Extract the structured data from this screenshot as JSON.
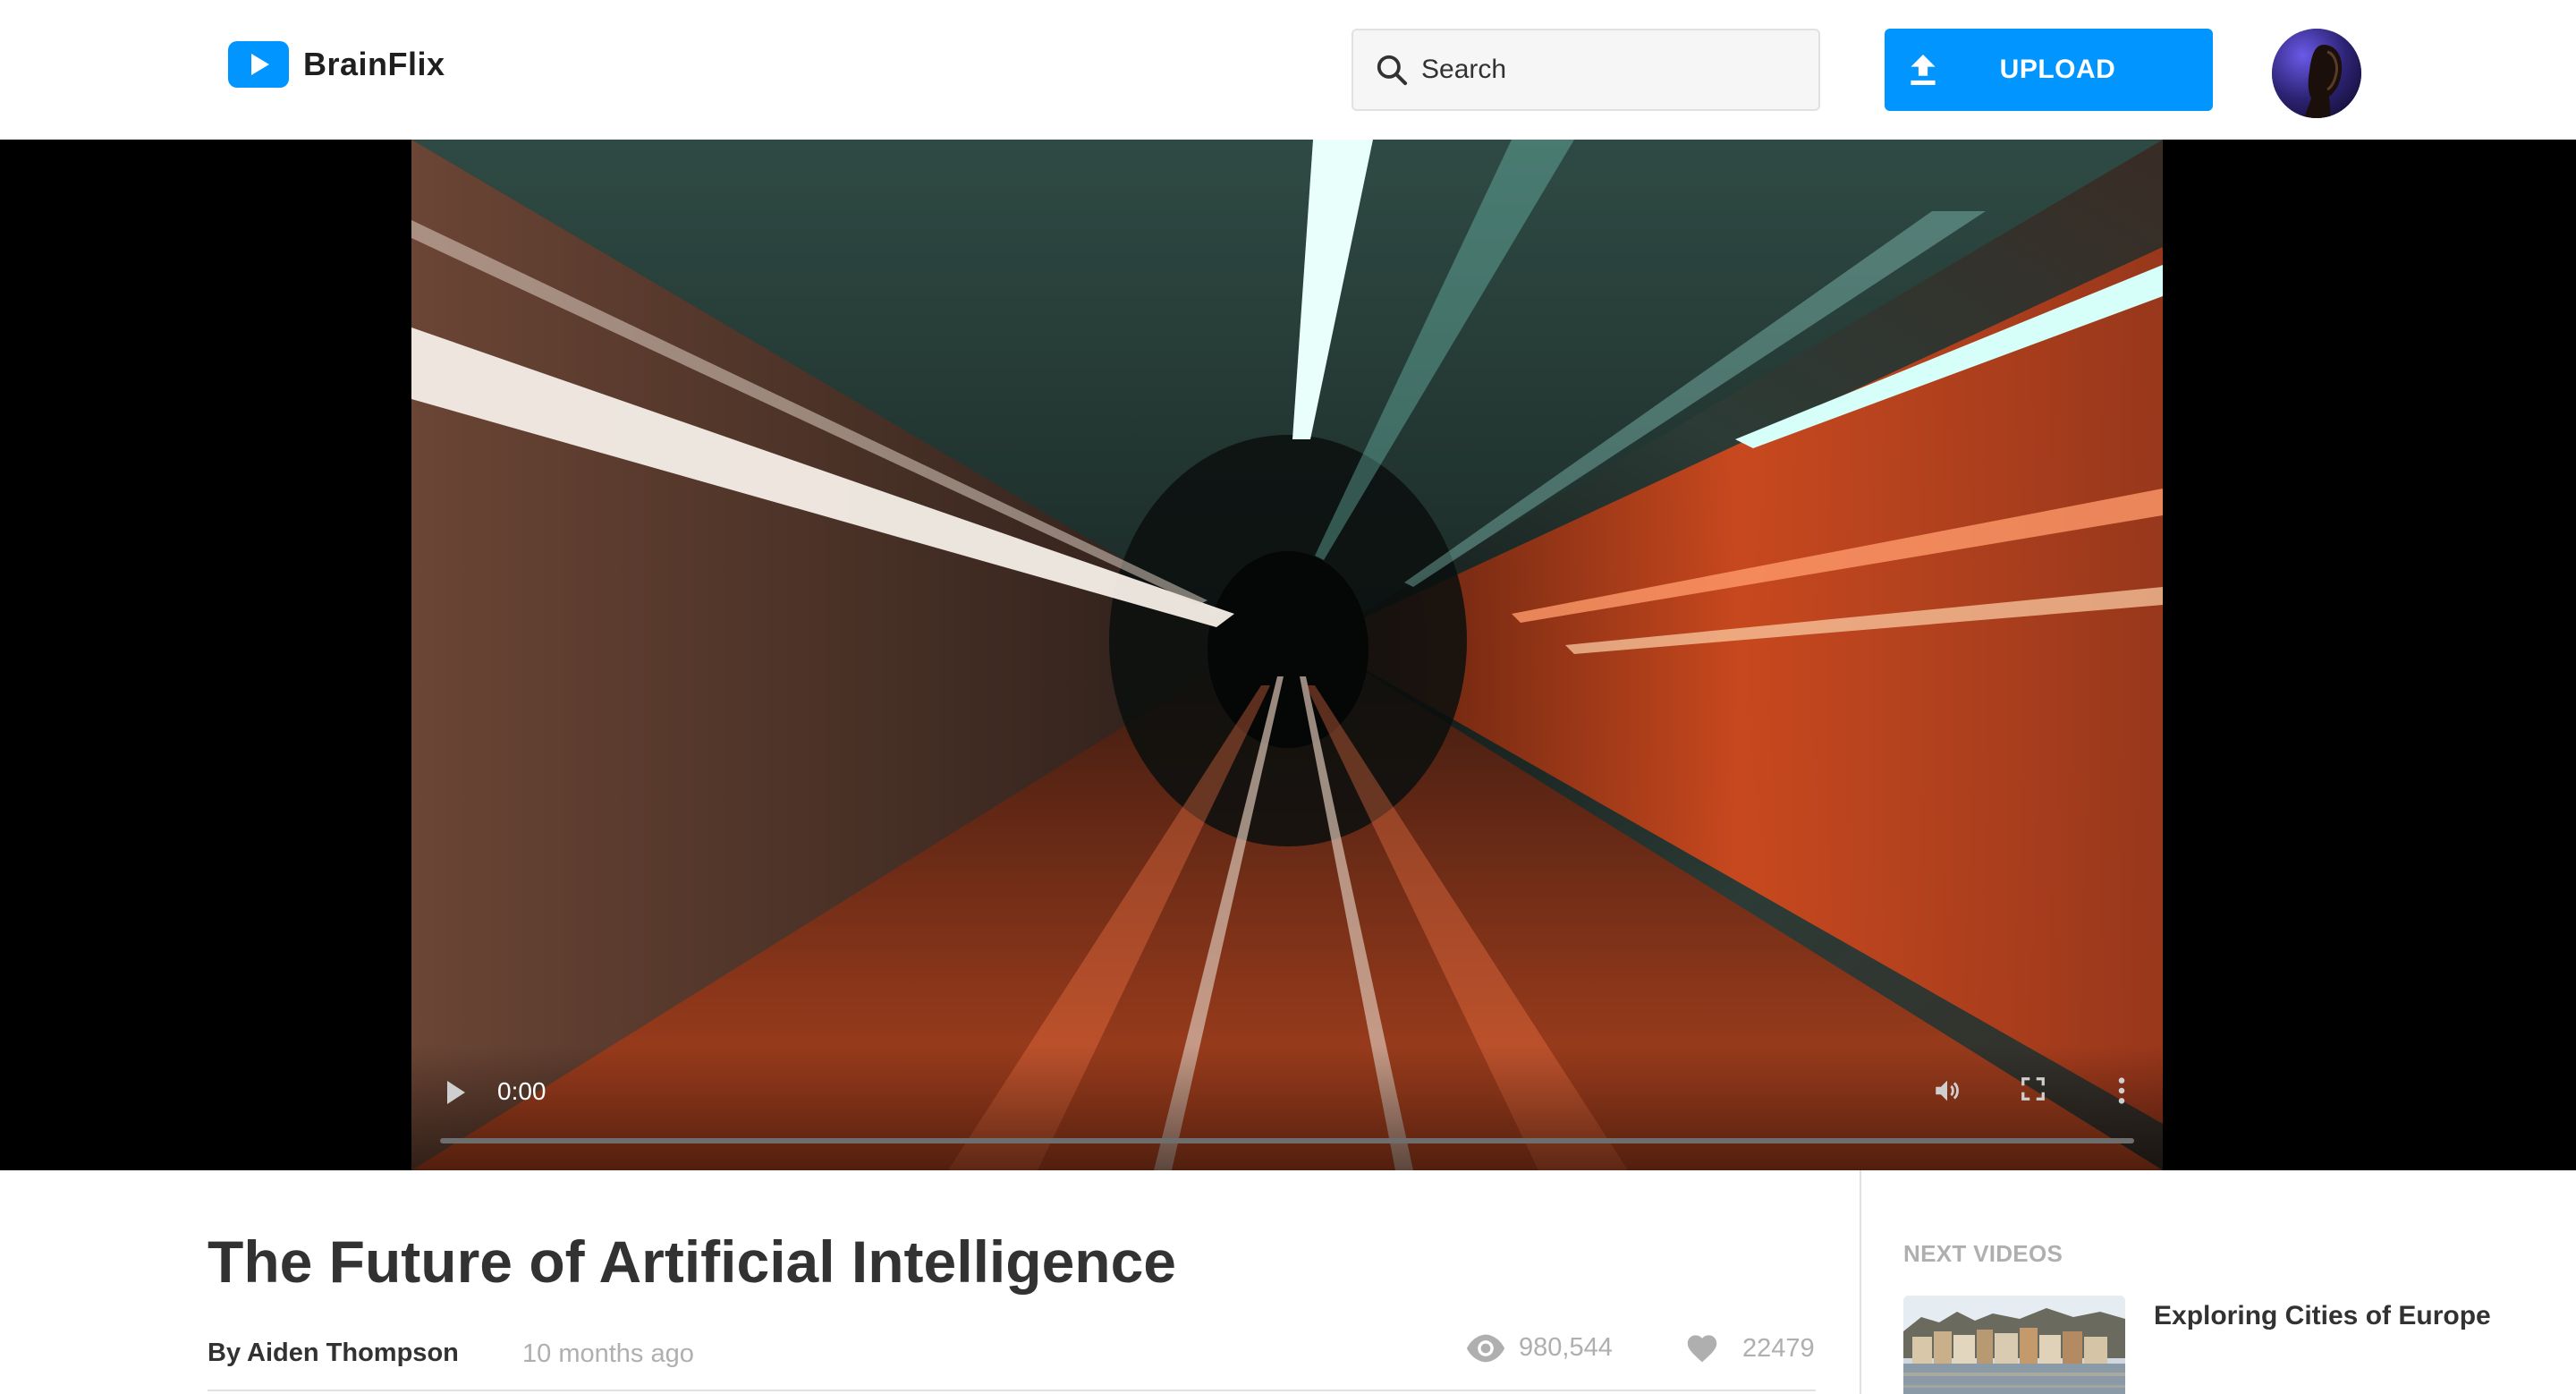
{
  "app": {
    "name": "BrainFlix",
    "brand_color": "#0095ff"
  },
  "header": {
    "search_placeholder": "Search",
    "upload_label": "UPLOAD",
    "icons": {
      "logo": "play-logo-icon",
      "search": "search-icon",
      "upload": "upload-icon",
      "avatar": "user-avatar"
    }
  },
  "player": {
    "current_time": "0:00",
    "progress": 0,
    "icons": [
      "play-icon",
      "volume-icon",
      "fullscreen-icon",
      "more-options-icon"
    ]
  },
  "video": {
    "title": "The Future of Artificial Intelligence",
    "author": "By Aiden Thompson",
    "posted": "10 months ago",
    "views": "980,544",
    "likes": "22479"
  },
  "next_videos": {
    "heading": "NEXT VIDEOS",
    "items": [
      {
        "title": "Exploring Cities of Europe"
      }
    ]
  }
}
